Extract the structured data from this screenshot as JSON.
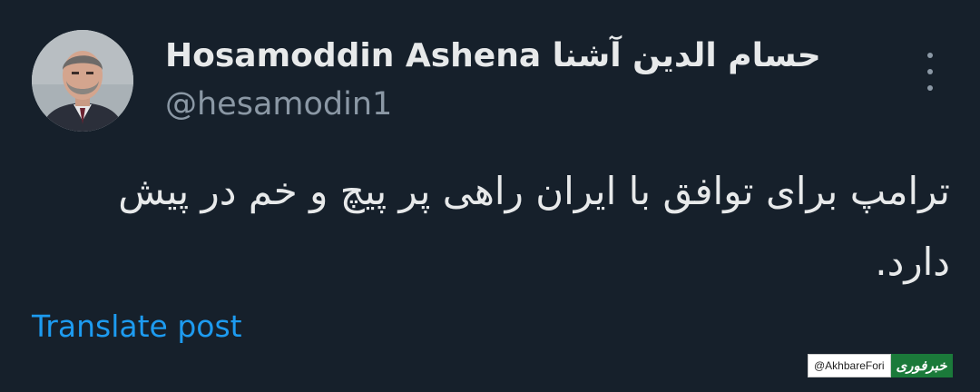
{
  "post": {
    "author_name": "Hosamoddin Ashena حسام الدین آشنا",
    "author_handle": "@hesamodin1",
    "text": "ترامپ برای توافق با ایران راهی پر پیچ و خم در پیش دارد.",
    "translate_label": "Translate post",
    "more_icon": "more-vertical-icon"
  },
  "watermark": {
    "handle": "@AkhbareFori",
    "logo_text": "خبرفوری",
    "logo_color": "#1b7a3a"
  },
  "colors": {
    "background": "#16202b",
    "primary_text": "#e7e9ea",
    "secondary_text": "#8b98a5",
    "link": "#1d9bf0"
  }
}
